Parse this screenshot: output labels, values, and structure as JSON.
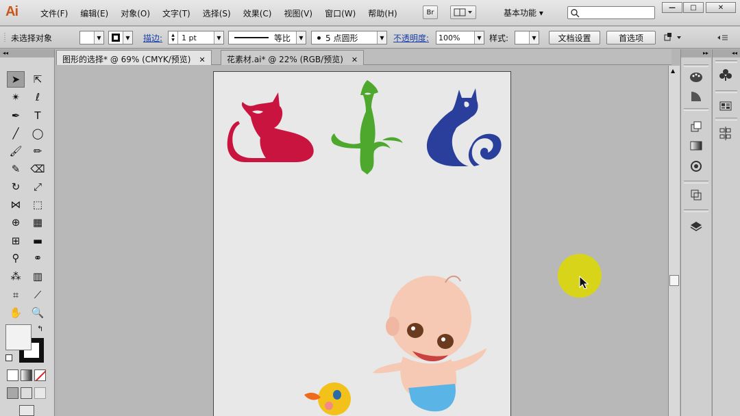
{
  "app": {
    "logo": "Ai",
    "menus": [
      "文件(F)",
      "编辑(E)",
      "对象(O)",
      "文字(T)",
      "选择(S)",
      "效果(C)",
      "视图(V)",
      "窗口(W)",
      "帮助(H)"
    ],
    "bridge_button": "Br",
    "workspace": "基本功能 ▾",
    "window_controls": [
      "—",
      "□",
      "✕"
    ]
  },
  "control_bar": {
    "selection_status": "未选择对象",
    "stroke_label": "描边:",
    "stroke_value": "1 pt",
    "stroke_profile": "等比",
    "brush": "5 点圆形",
    "opacity_label": "不透明度:",
    "opacity_value": "100%",
    "style_label": "样式:",
    "document_setup": "文档设置",
    "preferences": "首选项"
  },
  "tabs": [
    {
      "label": "图形的选择* @ 69% (CMYK/预览)",
      "active": true
    },
    {
      "label": "花素材.ai* @ 22% (RGB/预览)",
      "active": false
    }
  ],
  "toolbox": {
    "tools": [
      [
        "selection-tool",
        "direct-selection-tool"
      ],
      [
        "magic-wand-tool",
        "lasso-tool"
      ],
      [
        "pen-tool",
        "type-tool"
      ],
      [
        "line-tool",
        "ellipse-tool"
      ],
      [
        "paintbrush-tool",
        "pencil-tool"
      ],
      [
        "blob-brush-tool",
        "eraser-tool"
      ],
      [
        "rotate-tool",
        "scale-tool"
      ],
      [
        "width-tool",
        "free-transform-tool"
      ],
      [
        "shape-builder-tool",
        "perspective-grid-tool"
      ],
      [
        "mesh-tool",
        "gradient-tool"
      ],
      [
        "eyedropper-tool",
        "blend-tool"
      ],
      [
        "symbol-sprayer-tool",
        "column-graph-tool"
      ],
      [
        "artboard-tool",
        "slice-tool"
      ],
      [
        "hand-tool",
        "zoom-tool"
      ]
    ]
  },
  "colors": {
    "cat_red": "#c8143e",
    "cat_green": "#4ea82e",
    "cat_blue": "#2a3f9c",
    "highlight": "#d8d41a",
    "logo_orange": "#c9571a"
  }
}
